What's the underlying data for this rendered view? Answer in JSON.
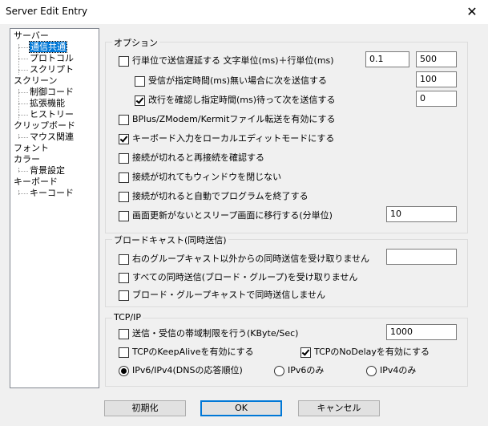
{
  "window": {
    "title": "Server Edit Entry",
    "close_glyph": "✕"
  },
  "tree": {
    "items": [
      {
        "label": "サーバー"
      },
      {
        "label": "通信共通"
      },
      {
        "label": "プロトコル"
      },
      {
        "label": "スクリプト"
      },
      {
        "label": "スクリーン"
      },
      {
        "label": "制御コード"
      },
      {
        "label": "拡張機能"
      },
      {
        "label": "ヒストリー"
      },
      {
        "label": "クリップボード"
      },
      {
        "label": "マウス関連"
      },
      {
        "label": "フォント"
      },
      {
        "label": "カラー"
      },
      {
        "label": "背景設定"
      },
      {
        "label": "キーボード"
      },
      {
        "label": "キーコード"
      }
    ],
    "selected": "通信共通"
  },
  "options": {
    "title": "オプション",
    "line_delay": {
      "label": "行単位で送信遅延する 文字単位(ms)＋行単位(ms)",
      "checked": false,
      "char_ms": "0.1",
      "line_ms": "500"
    },
    "no_recv": {
      "label": "受信が指定時間(ms)無い場合に次を送信する",
      "checked": false,
      "value": "100"
    },
    "wait_newline": {
      "label": "改行を確認し指定時間(ms)待って次を送信する",
      "checked": true,
      "value": "0"
    },
    "bplus": {
      "label": "BPlus/ZModem/Kermitファイル転送を有効にする",
      "checked": false
    },
    "local_edit": {
      "label": "キーボード入力をローカルエディットモードにする",
      "checked": true
    },
    "reconnect_confirm": {
      "label": "接続が切れると再接続を確認する",
      "checked": false
    },
    "keep_window": {
      "label": "接続が切れてもウィンドウを閉じない",
      "checked": false
    },
    "auto_exit": {
      "label": "接続が切れると自動でプログラムを終了する",
      "checked": false
    },
    "sleep": {
      "label": "画面更新がないとスリープ画面に移行する(分単位)",
      "checked": false,
      "value": "10"
    }
  },
  "broadcast": {
    "title": "ブロードキャスト(同時送信)",
    "reject_except": {
      "label": "右のグループキャスト以外からの同時送信を受け取りません",
      "checked": false,
      "value": ""
    },
    "reject_all": {
      "label": "すべての同時送信(ブロード・グループ)を受け取りません",
      "checked": false
    },
    "no_send": {
      "label": "ブロード・グループキャストで同時送信しません",
      "checked": false
    }
  },
  "tcpip": {
    "title": "TCP/IP",
    "bandwidth": {
      "label": "送信・受信の帯域制限を行う(KByte/Sec)",
      "checked": false,
      "value": "1000"
    },
    "keepalive": {
      "label": "TCPのKeepAliveを有効にする",
      "checked": false
    },
    "nodelay": {
      "label": "TCPのNoDelayを有効にする",
      "checked": true
    },
    "ip_mode": {
      "options": [
        "IPv6/IPv4(DNSの応答順位)",
        "IPv6のみ",
        "IPv4のみ"
      ],
      "selected": "IPv6/IPv4(DNSの応答順位)"
    }
  },
  "buttons": {
    "reset": "初期化",
    "ok": "OK",
    "cancel": "キャンセル"
  }
}
